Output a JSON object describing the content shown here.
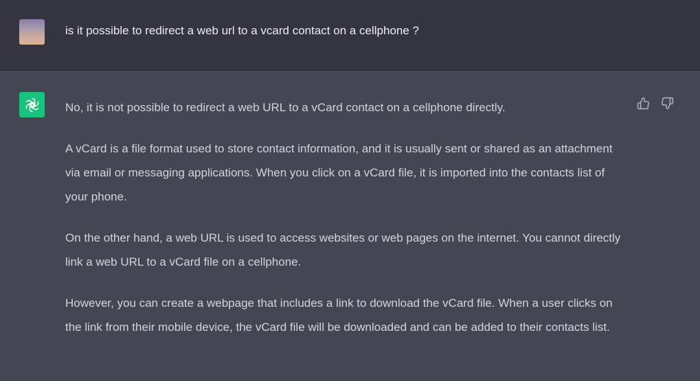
{
  "user_message": {
    "avatar_icon": "user-avatar-gradient",
    "text": "is it possible to redirect a web url to a vcard contact on a cellphone ?"
  },
  "assistant_message": {
    "avatar_icon": "openai-logo-icon",
    "paragraphs": [
      "No, it is not possible to redirect a web URL to a vCard contact on a cellphone directly.",
      "A vCard is a file format used to store contact information, and it is usually sent or shared as an attachment via email or messaging applications. When you click on a vCard file, it is imported into the contacts list of your phone.",
      "On the other hand, a web URL is used to access websites or web pages on the internet. You cannot directly link a web URL to a vCard file on a cellphone.",
      "However, you can create a webpage that includes a link to download the vCard file. When a user clicks on the link from their mobile device, the vCard file will be downloaded and can be added to their contacts list."
    ],
    "feedback": {
      "thumbs_up_icon": "thumbs-up-icon",
      "thumbs_down_icon": "thumbs-down-icon"
    }
  },
  "colors": {
    "user_bg": "#343541",
    "assistant_bg": "#444654",
    "logo_bg": "#19c37d",
    "text": "#d1d5db",
    "user_text": "#ececf1",
    "icon": "#acacbe"
  }
}
